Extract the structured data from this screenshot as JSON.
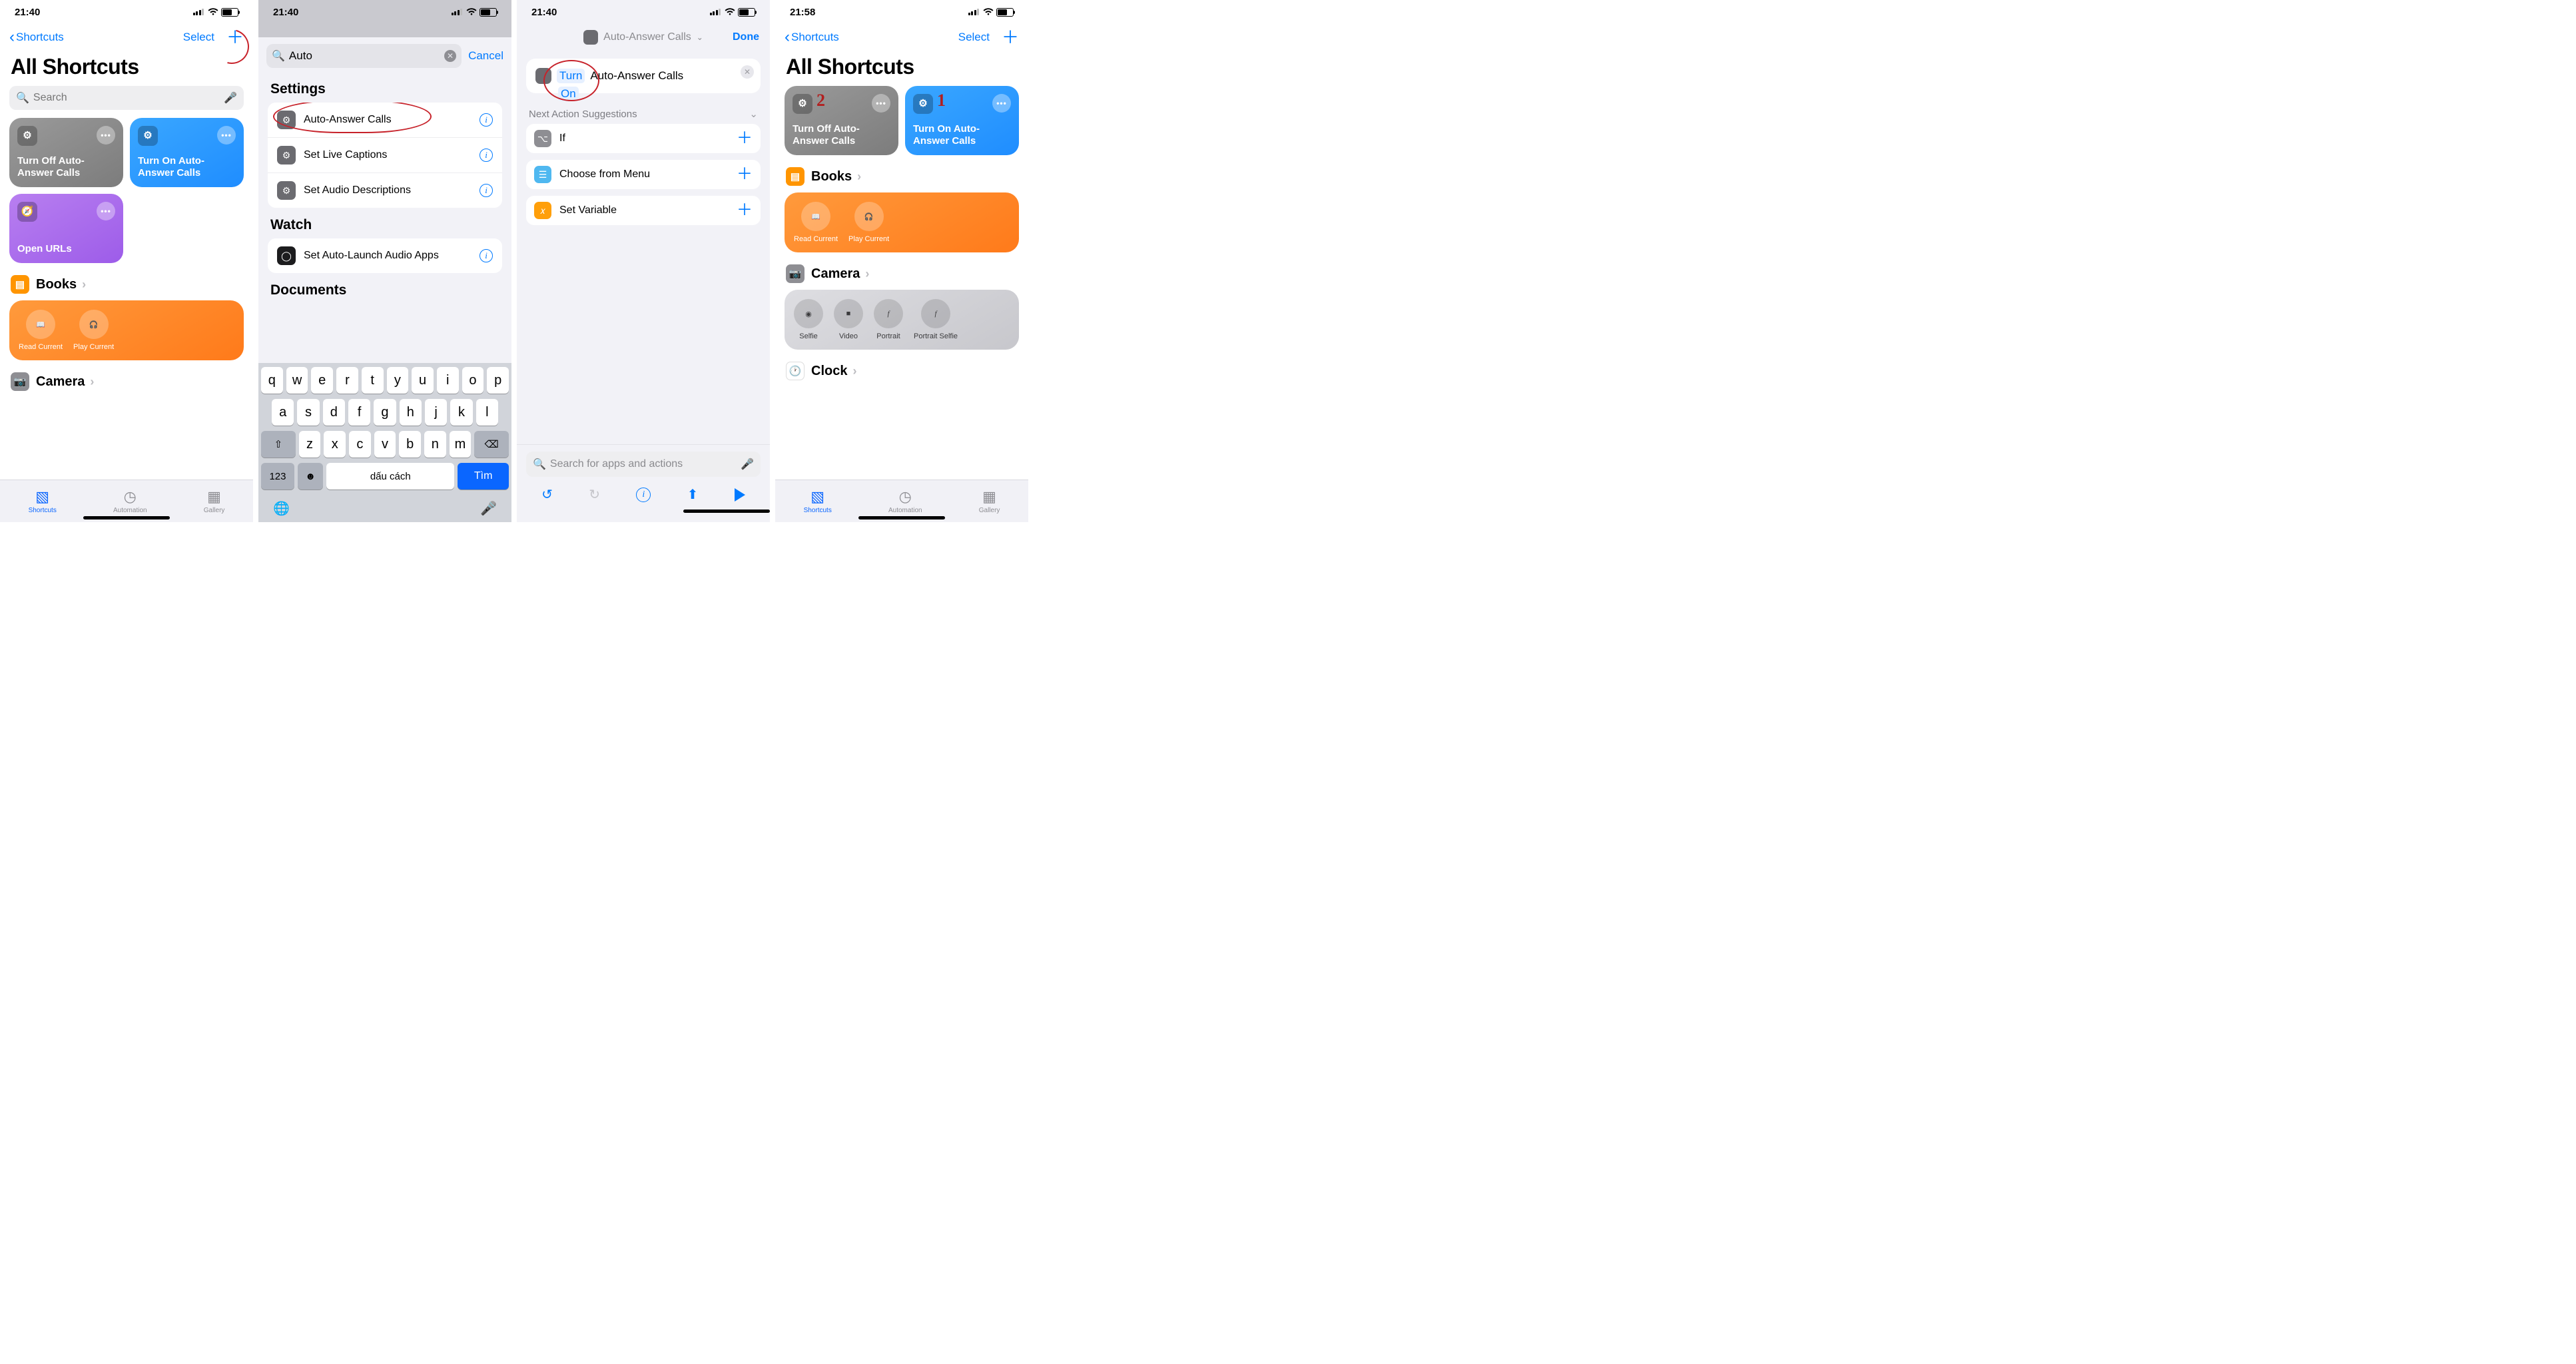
{
  "status": {
    "time_main": "21:40",
    "time_alt": "21:58"
  },
  "nav": {
    "back": "Shortcuts",
    "select": "Select",
    "title": "All Shortcuts",
    "search_placeholder": "Search"
  },
  "tiles": {
    "off": "Turn Off Auto-Answer Calls",
    "on": "Turn On Auto-Answer Calls",
    "urls": "Open URLs"
  },
  "sections": {
    "books": "Books",
    "camera": "Camera",
    "clock": "Clock"
  },
  "books_actions": {
    "read": "Read Current",
    "play": "Play Current"
  },
  "camera_actions": {
    "selfie": "Selfie",
    "video": "Video",
    "portrait": "Portrait",
    "pselfie": "Portrait Selfie"
  },
  "tabs": {
    "shortcuts": "Shortcuts",
    "automation": "Automation",
    "gallery": "Gallery"
  },
  "sheet": {
    "search_value": "Auto",
    "cancel": "Cancel",
    "group_settings": "Settings",
    "group_watch": "Watch",
    "group_documents": "Documents",
    "items": {
      "auto_answer": "Auto-Answer Calls",
      "live_captions": "Set Live Captions",
      "audio_desc": "Set Audio Descriptions",
      "autolaunch": "Set Auto-Launch Audio Apps"
    }
  },
  "keyboard": {
    "row1": [
      "q",
      "w",
      "e",
      "r",
      "t",
      "y",
      "u",
      "i",
      "o",
      "p"
    ],
    "row2": [
      "a",
      "s",
      "d",
      "f",
      "g",
      "h",
      "j",
      "k",
      "l"
    ],
    "row3": [
      "z",
      "x",
      "c",
      "v",
      "b",
      "n",
      "m"
    ],
    "num": "123",
    "space": "dấu cách",
    "return": "Tìm"
  },
  "editor": {
    "title": "Auto-Answer Calls",
    "done": "Done",
    "tok_turn": "Turn",
    "tok_on": "On",
    "tok_label": "Auto-Answer Calls",
    "suggestions_hdr": "Next Action Suggestions",
    "if": "If",
    "menu": "Choose from Menu",
    "var": "Set Variable",
    "search_placeholder": "Search for apps and actions"
  },
  "marks": {
    "two": "2",
    "one": "1"
  }
}
